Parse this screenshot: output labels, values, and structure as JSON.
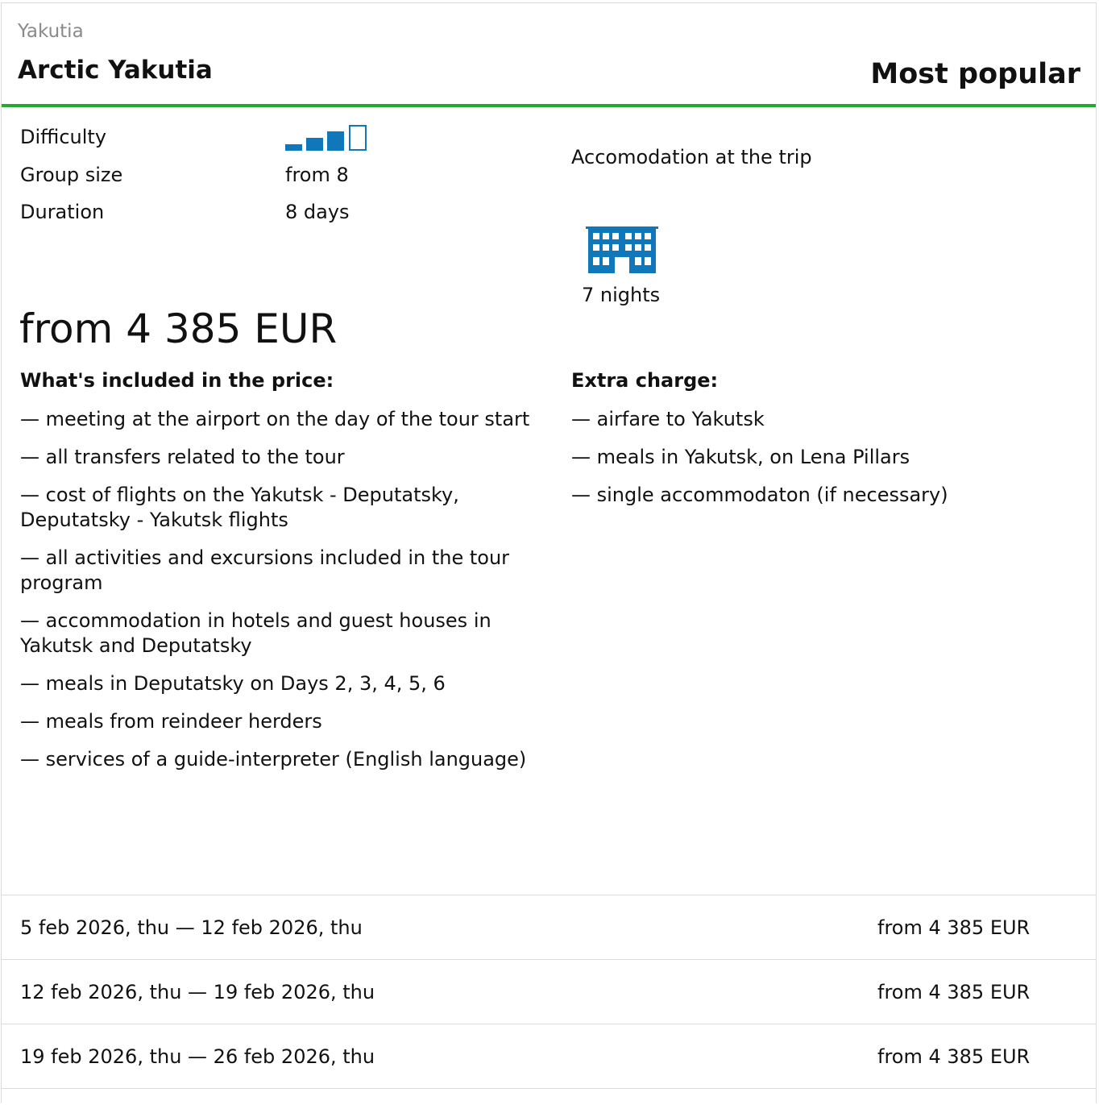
{
  "tour": {
    "region": "Yakutia",
    "title": "Arctic Yakutia",
    "badge": "Most popular",
    "accent_color": "#22aa33",
    "icon_color": "#1177bb"
  },
  "details": {
    "difficulty_label": "Difficulty",
    "difficulty_icon": "difficulty-bars-icon",
    "difficulty_level": 3,
    "difficulty_max": 4,
    "group_size_label": "Group size",
    "group_size_value": "from 8",
    "duration_label": "Duration",
    "duration_value": "8 days"
  },
  "accommodation": {
    "label": "Accomodation at the trip",
    "icon": "hotel-icon",
    "nights": "7 nights"
  },
  "price": "from 4 385 EUR",
  "included": {
    "heading": "What's included in the price:",
    "items": [
      "— meeting at the airport on the day of the tour start",
      "— all transfers related to the tour",
      "— cost of flights on the Yakutsk - Deputatsky, Deputatsky - Yakutsk flights",
      "— all activities and excursions included in the tour program",
      "— accommodation in hotels and guest houses in Yakutsk and Deputatsky",
      "— meals in Deputatsky on Days 2, 3, 4, 5, 6",
      "— meals from reindeer herders",
      "— services of a guide-interpreter (English language)"
    ]
  },
  "extra": {
    "heading": "Extra charge:",
    "items": [
      "— airfare to Yakutsk",
      "— meals in Yakutsk, on Lena Pillars",
      "— single accommodaton (if necessary)"
    ]
  },
  "dates": [
    {
      "range": "5 feb 2026, thu — 12 feb 2026, thu",
      "price": "from 4 385 EUR"
    },
    {
      "range": "12 feb 2026, thu — 19 feb 2026, thu",
      "price": "from 4 385 EUR"
    },
    {
      "range": "19 feb 2026, thu — 26 feb 2026, thu",
      "price": "from 4 385 EUR"
    }
  ]
}
